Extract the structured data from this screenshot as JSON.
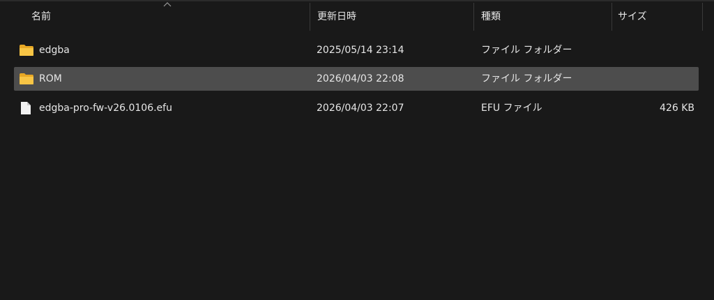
{
  "columns": {
    "name": "名前",
    "date": "更新日時",
    "type": "種類",
    "size": "サイズ"
  },
  "files": [
    {
      "name": "edgba",
      "date": "2025/05/14 23:14",
      "type": "ファイル フォルダー",
      "size": "",
      "icon": "folder-icon",
      "selected": false
    },
    {
      "name": "ROM",
      "date": "2026/04/03 22:08",
      "type": "ファイル フォルダー",
      "size": "",
      "icon": "folder-icon",
      "selected": true
    },
    {
      "name": "edgba-pro-fw-v26.0106.efu",
      "date": "2026/04/03 22:07",
      "type": "EFU ファイル",
      "size": "426 KB",
      "icon": "file-icon",
      "selected": false
    }
  ],
  "colors": {
    "background": "#191919",
    "selection": "#4d4d4d",
    "folder": "#f8c545"
  }
}
